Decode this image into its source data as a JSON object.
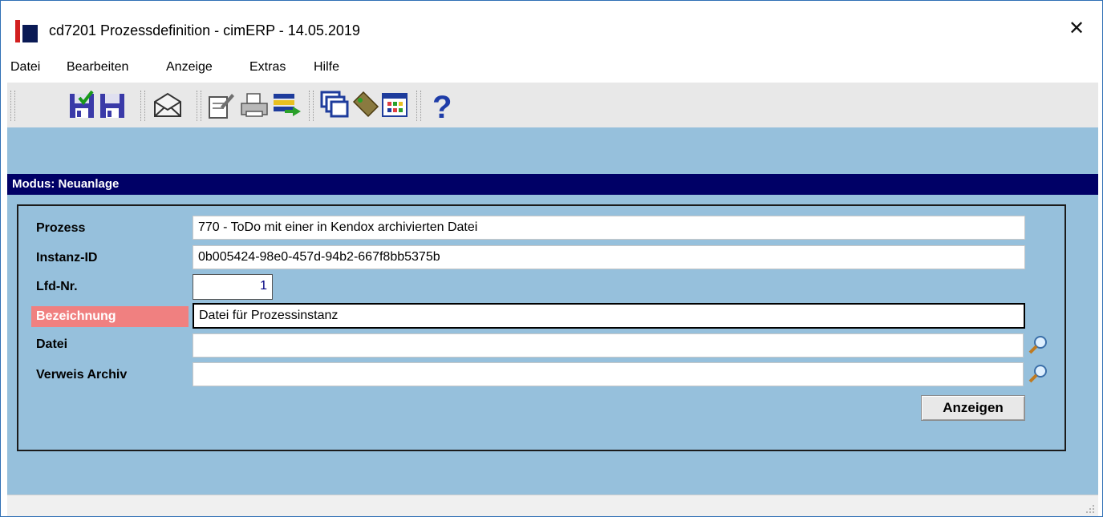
{
  "window": {
    "title": "cd7201 Prozessdefinition - cimERP - 14.05.2019",
    "close_glyph": "✕"
  },
  "menu": [
    "Datei",
    "Bearbeiten",
    "Anzeige",
    "Extras",
    "Hilfe"
  ],
  "toolbar": {
    "buttons": [
      "save-check-icon",
      "save-icon",
      "mail-icon",
      "edit-notes-icon",
      "printer-icon",
      "list-arrow-icon",
      "windows-icon",
      "tag-icon",
      "grid-icon",
      "help-icon"
    ]
  },
  "mode": {
    "label": "Modus: Neuanlage"
  },
  "form": {
    "prozess": {
      "label": "Prozess",
      "value": "770 - ToDo mit einer in Kendox archivierten Datei"
    },
    "instanz": {
      "label": "Instanz-ID",
      "value": "0b005424-98e0-457d-94b2-667f8bb5375b"
    },
    "lfd": {
      "label": "Lfd-Nr.",
      "value": "1"
    },
    "bezeichnung": {
      "label": "Bezeichnung",
      "value": "Datei für Prozessinstanz"
    },
    "datei": {
      "label": "Datei",
      "value": ""
    },
    "verweis": {
      "label": "Verweis Archiv",
      "value": ""
    },
    "anzeigen_button": "Anzeigen"
  },
  "colors": {
    "content_bg": "#96c0dc",
    "mode_bar": "#000066",
    "required_label": "#f08080"
  }
}
